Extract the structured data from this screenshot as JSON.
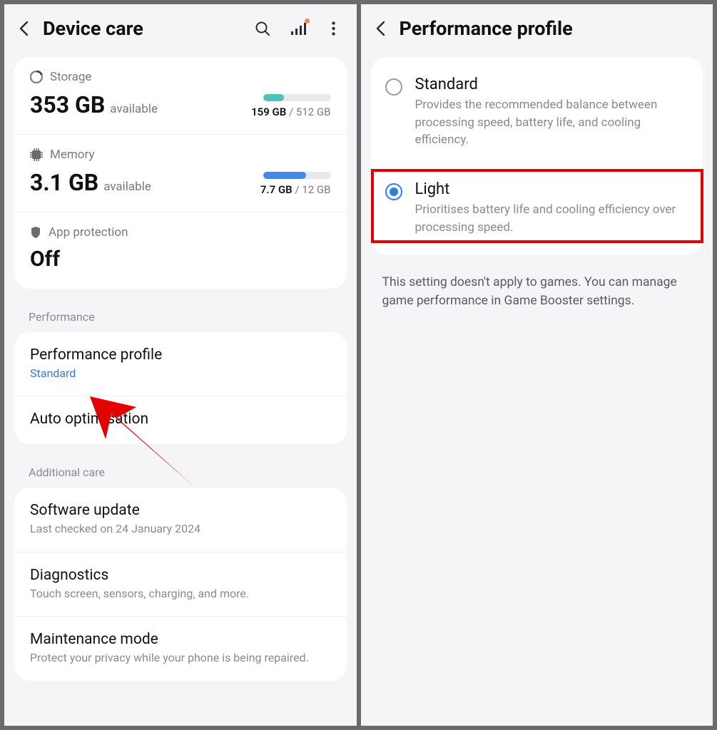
{
  "left": {
    "title": "Device care",
    "storage": {
      "label": "Storage",
      "value": "353 GB",
      "suffix": "available",
      "used": "159 GB",
      "total": "512 GB"
    },
    "memory": {
      "label": "Memory",
      "value": "3.1 GB",
      "suffix": "available",
      "used": "7.7 GB",
      "total": "12 GB"
    },
    "app_protection": {
      "label": "App protection",
      "status": "Off"
    },
    "section_performance": "Performance",
    "perf_profile": {
      "title": "Performance profile",
      "value": "Standard"
    },
    "auto_opt": {
      "title": "Auto optimisation"
    },
    "section_additional": "Additional care",
    "software_update": {
      "title": "Software update",
      "sub": "Last checked on 24 January 2024"
    },
    "diagnostics": {
      "title": "Diagnostics",
      "sub": "Touch screen, sensors, charging, and more."
    },
    "maintenance": {
      "title": "Maintenance mode",
      "sub": "Protect your privacy while your phone is being repaired."
    }
  },
  "right": {
    "title": "Performance profile",
    "options": {
      "standard": {
        "title": "Standard",
        "desc": "Provides the recommended balance between processing speed, battery life, and cooling efficiency."
      },
      "light": {
        "title": "Light",
        "desc": "Prioritises battery life and cooling efficiency over processing speed."
      }
    },
    "note": "This setting doesn't apply to games. You can manage game performance in Game Booster settings."
  }
}
